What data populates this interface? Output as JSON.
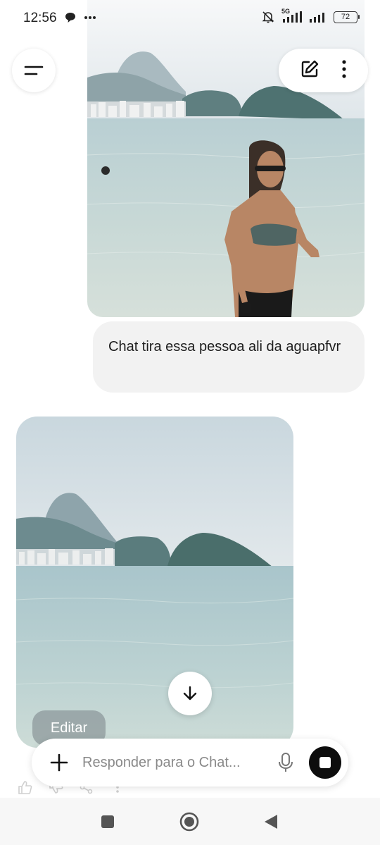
{
  "status_bar": {
    "time": "12:56",
    "network": "5G",
    "battery": "72"
  },
  "conversation": {
    "user_message": "Chat tira essa pessoa ali da aguapfvr",
    "edit_label": "Editar"
  },
  "composer": {
    "placeholder": "Responder para o Chat..."
  },
  "icons": {
    "menu": "menu-icon",
    "new_chat": "edit-icon",
    "more": "more-vertical-icon",
    "scroll_down": "arrow-down-icon",
    "plus": "plus-icon",
    "mic": "mic-icon",
    "stop": "stop-icon"
  },
  "colors": {
    "background": "#ffffff",
    "bubble": "#f2f2f2",
    "stop_button": "#0d0d0d"
  }
}
